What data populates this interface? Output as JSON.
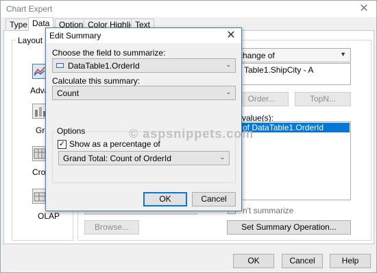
{
  "window": {
    "title": "Chart Expert",
    "tabs": [
      "Type",
      "Data",
      "Options",
      "Color Highlight",
      "Text"
    ],
    "layout_group_label": "Layout",
    "layout_items": [
      "Advanced",
      "Group",
      "Cross-Tab",
      "OLAP"
    ],
    "change_of_value": "change of",
    "change_of_list": [
      "Table1.ShipCity - A"
    ],
    "order_button": "Order...",
    "topn_button": "TopN...",
    "show_values_label": "value(s):",
    "show_values_list": [
      "of DataTable1.OrderId"
    ],
    "dont_summarize_label": "n't summarize",
    "browse_button": "Browse...",
    "set_summary_button": "Set Summary Operation...",
    "ok": "OK",
    "cancel": "Cancel",
    "help": "Help"
  },
  "dialog": {
    "title": "Edit Summary",
    "field_label": "Choose the field to summarize:",
    "field_value": "DataTable1.OrderId",
    "calc_label": "Calculate this summary:",
    "calc_value": "Count",
    "options_label": "Options",
    "percent_checkbox_label": "Show as a percentage of",
    "percent_checked": true,
    "percent_of_value": "Grand Total: Count of OrderId",
    "ok": "OK",
    "cancel": "Cancel"
  },
  "watermark": "© aspsnippets.com",
  "icons": {
    "close": "close-icon",
    "dropdown": "chevron-down-icon",
    "field": "field-icon",
    "checkbox": "checkmark-icon"
  }
}
